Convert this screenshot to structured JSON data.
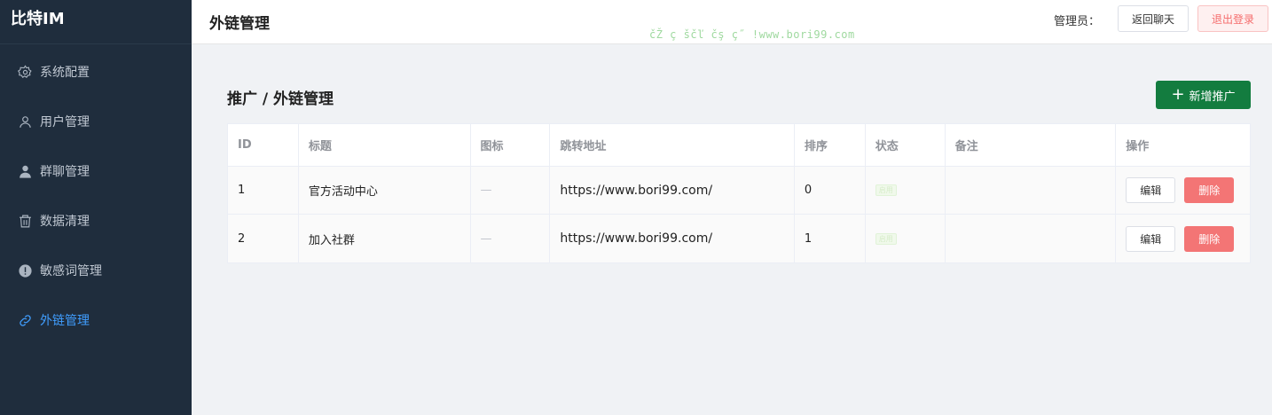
{
  "app": {
    "brand": "比特IM"
  },
  "sidebar": {
    "items": [
      {
        "label": "系统配置",
        "icon": "gear-icon",
        "active": false
      },
      {
        "label": "用户管理",
        "icon": "user-icon",
        "active": false
      },
      {
        "label": "群聊管理",
        "icon": "user-group-icon",
        "active": false
      },
      {
        "label": "数据清理",
        "icon": "trash-icon",
        "active": false
      },
      {
        "label": "敏感词管理",
        "icon": "warning-icon",
        "active": false
      },
      {
        "label": "外链管理",
        "icon": "link-icon",
        "active": true
      }
    ]
  },
  "header": {
    "title": "外链管理",
    "watermark": "čŽ ç ščľ čş ç˝ !www.bori99.com",
    "admin_label": "管理员：",
    "back_button": "返回聊天",
    "logout_button": "退出登录"
  },
  "main": {
    "section_title": "推广 / 外链管理",
    "add_button": "新增推广",
    "table": {
      "headers": [
        "ID",
        "标题",
        "图标",
        "跳转地址",
        "排序",
        "状态",
        "备注",
        "操作"
      ],
      "rows": [
        {
          "id": "1",
          "title": "官方活动中心",
          "icon": "—",
          "url": "https://www.bori99.com/",
          "sort": "0",
          "status": "启用",
          "note": "",
          "edit": "编辑",
          "delete": "删除"
        },
        {
          "id": "2",
          "title": "加入社群",
          "icon": "—",
          "url": "https://www.bori99.com/",
          "sort": "1",
          "status": "启用",
          "note": "",
          "edit": "编辑",
          "delete": "删除"
        }
      ]
    }
  },
  "colors": {
    "sidebar_bg": "#1f2d3d",
    "active": "#409eff",
    "primary_green": "#137c3f",
    "danger": "#f37575"
  }
}
